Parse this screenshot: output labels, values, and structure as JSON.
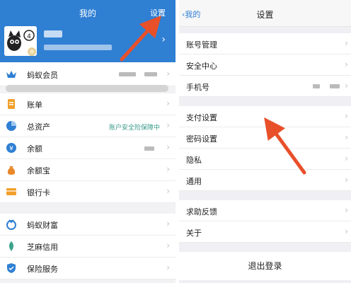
{
  "left": {
    "title": "我的",
    "settings_link": "设置",
    "chevron": "›",
    "member": {
      "label": "蚂蚁会员"
    },
    "items": [
      {
        "label": "账单",
        "icon": "bill-icon",
        "color": "#f0a02a"
      },
      {
        "label": "总资产",
        "icon": "pie-chart-icon",
        "color": "#2f7fd3",
        "value": "账户安全险保障中"
      },
      {
        "label": "余额",
        "icon": "yuan-icon",
        "color": "#2f7fd3"
      },
      {
        "label": "余额宝",
        "icon": "money-bag-icon",
        "color": "#e8882a"
      },
      {
        "label": "银行卡",
        "icon": "bank-card-icon",
        "color": "#f0a02a"
      }
    ],
    "items2": [
      {
        "label": "蚂蚁财富",
        "icon": "wealth-icon",
        "color": "#2f7fd3"
      },
      {
        "label": "芝麻信用",
        "icon": "sesame-icon",
        "color": "#3aa38a"
      },
      {
        "label": "保险服务",
        "icon": "shield-icon",
        "color": "#2f7fd3"
      }
    ]
  },
  "right": {
    "back": "‹我的",
    "title": "设置",
    "group1": [
      "账号管理",
      "安全中心",
      "手机号"
    ],
    "group2": [
      "支付设置",
      "密码设置",
      "隐私",
      "通用"
    ],
    "group3": [
      "求助反馈",
      "关于"
    ],
    "logout": "退出登录"
  },
  "colors": {
    "header_blue": "#2f7fd3",
    "arrow_red": "#e8502a"
  }
}
